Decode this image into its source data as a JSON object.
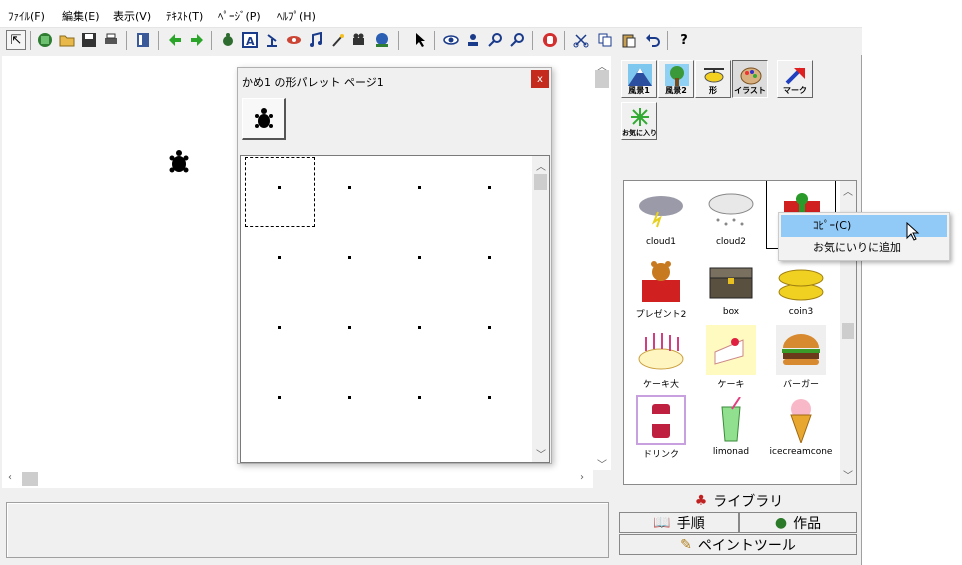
{
  "menu": [
    "ﾌｧｲﾙ(F)",
    "編集(E)",
    "表示(V)",
    "ﾃｷｽﾄ(T)",
    "ﾍﾟｰｼﾞ(P)",
    "ﾍﾙﾌﾟ(H)"
  ],
  "toolbar_help": "?",
  "palette": {
    "title": "かめ1 の形パレット ページ1",
    "close": "x"
  },
  "categories": [
    {
      "label": "風景1",
      "icon": "mountain-icon"
    },
    {
      "label": "風景2",
      "icon": "tree-icon"
    },
    {
      "label": "形",
      "icon": "helicopter-icon"
    },
    {
      "label": "イラスト",
      "icon": "palette-icon"
    },
    {
      "label": "マーク",
      "icon": "arrow-icon"
    },
    {
      "label": "お気に入り",
      "icon": "flower-icon"
    }
  ],
  "library_items": [
    {
      "label": "cloud1",
      "icon": "storm-cloud-icon"
    },
    {
      "label": "cloud2",
      "icon": "snow-cloud-icon"
    },
    {
      "label": "",
      "icon": "gift-box-icon"
    },
    {
      "label": "プレゼント2",
      "icon": "teddy-gift-icon"
    },
    {
      "label": "box",
      "icon": "treasure-chest-icon"
    },
    {
      "label": "coin3",
      "icon": "coins-icon"
    },
    {
      "label": "ケーキ大",
      "icon": "birthday-cake-icon"
    },
    {
      "label": "ケーキ",
      "icon": "cake-slice-icon"
    },
    {
      "label": "バーガー",
      "icon": "burger-icon"
    },
    {
      "label": "ドリンク",
      "icon": "soda-can-icon"
    },
    {
      "label": "limonad",
      "icon": "lemonade-icon"
    },
    {
      "label": "icecreamcone",
      "icon": "ice-cream-icon"
    }
  ],
  "context_menu": {
    "copy": "ｺﾋﾟｰ(C)",
    "add_favorite": "お気にいりに追加"
  },
  "bottom_tabs": {
    "library": "ライブラリ",
    "procedure": "手順",
    "works": "作品",
    "paint": "ペイントツール"
  },
  "colors": {
    "close": "#c42b1c",
    "highlight": "#91c9f7"
  }
}
